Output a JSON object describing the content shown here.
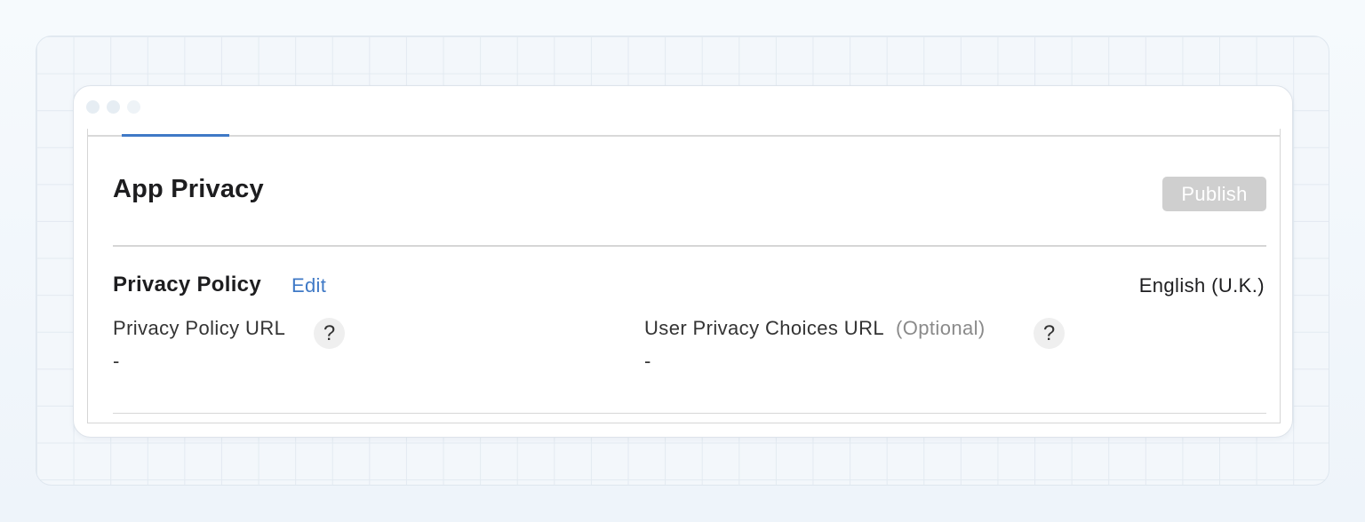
{
  "header": {
    "title": "App Privacy",
    "publish_label": "Publish"
  },
  "privacy_policy": {
    "section_title": "Privacy Policy",
    "edit_label": "Edit",
    "language": "English (U.K.)",
    "fields": [
      {
        "label": "Privacy Policy URL",
        "optional_note": "",
        "help_icon": "?",
        "value": "-"
      },
      {
        "label": "User Privacy Choices URL",
        "optional_note": "(Optional)",
        "help_icon": "?",
        "value": "-"
      }
    ]
  },
  "colors": {
    "accent": "#3f79c6",
    "publish_disabled": "#cfcfcf",
    "text_primary": "#1d1d1f",
    "text_secondary": "#8a8a8a"
  }
}
